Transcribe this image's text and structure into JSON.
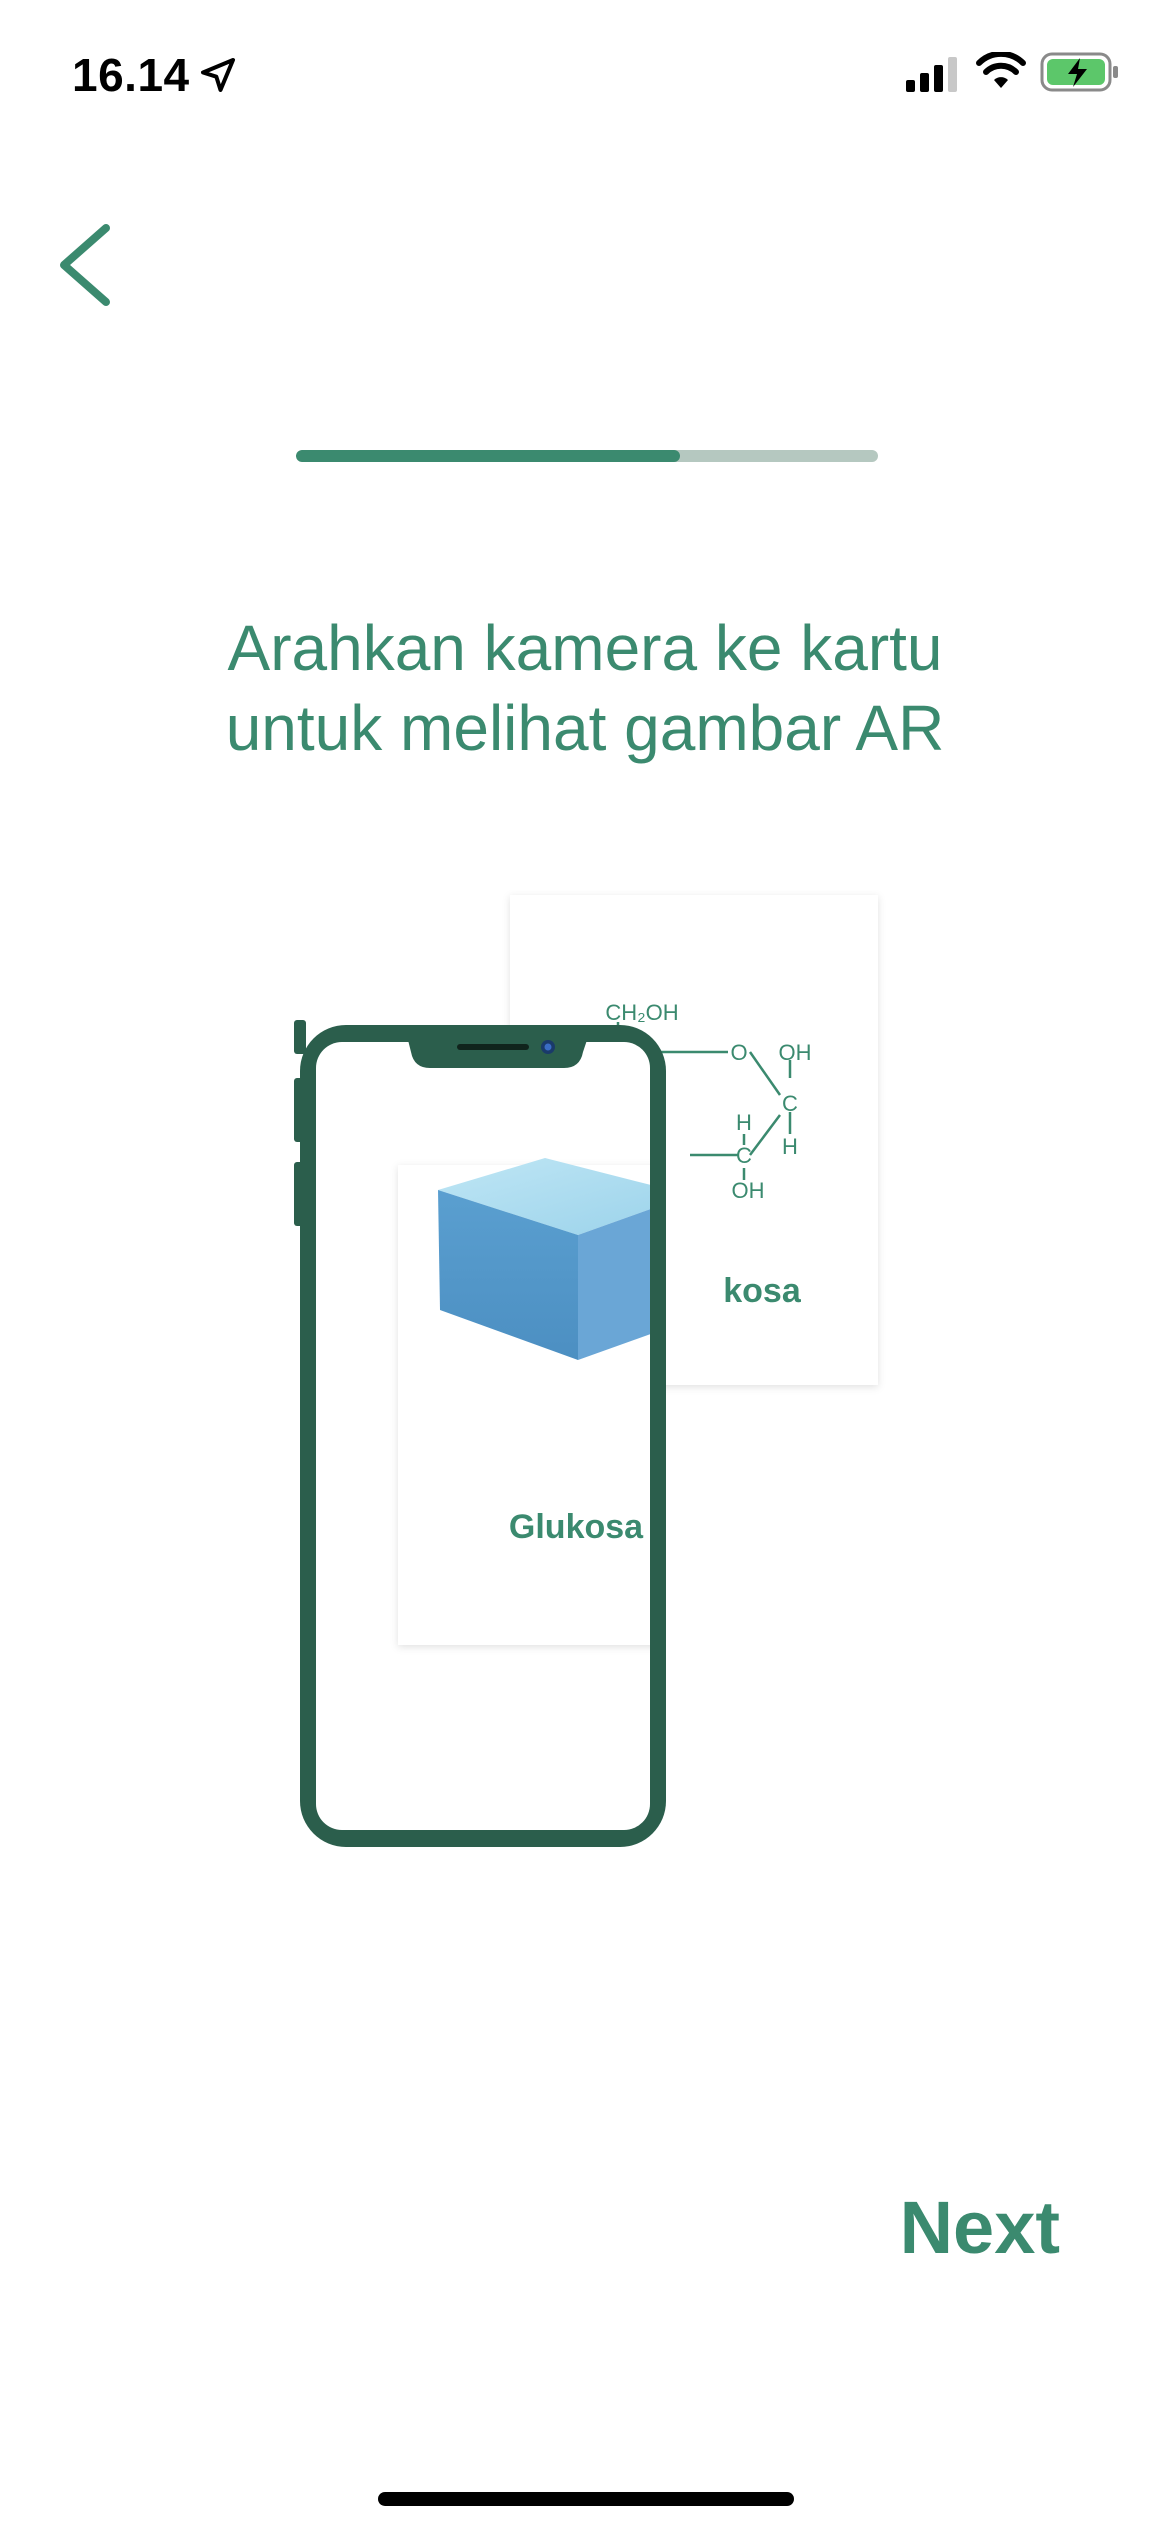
{
  "status_bar": {
    "time": "16.14",
    "icons": [
      "location-arrow-icon",
      "cellular-signal-icon",
      "wifi-icon",
      "battery-charging-icon"
    ]
  },
  "nav": {
    "back_icon": "chevron-left-icon"
  },
  "progress": {
    "value": 0.66
  },
  "instruction": {
    "line1": "Arahkan kamera ke kartu",
    "line2": "untuk melihat gambar AR"
  },
  "illustration": {
    "back_card": {
      "formula_top": "CH₂OH",
      "labels": [
        "O",
        "OH",
        "C",
        "H",
        "H",
        "C",
        "OH"
      ],
      "partial_name": "kosa"
    },
    "front_card_name": "Glukosa"
  },
  "next_label": "Next",
  "colors": {
    "accent": "#3b8a6f",
    "phone_frame": "#2b5e4c",
    "progress_track": "#b5c8c0"
  }
}
